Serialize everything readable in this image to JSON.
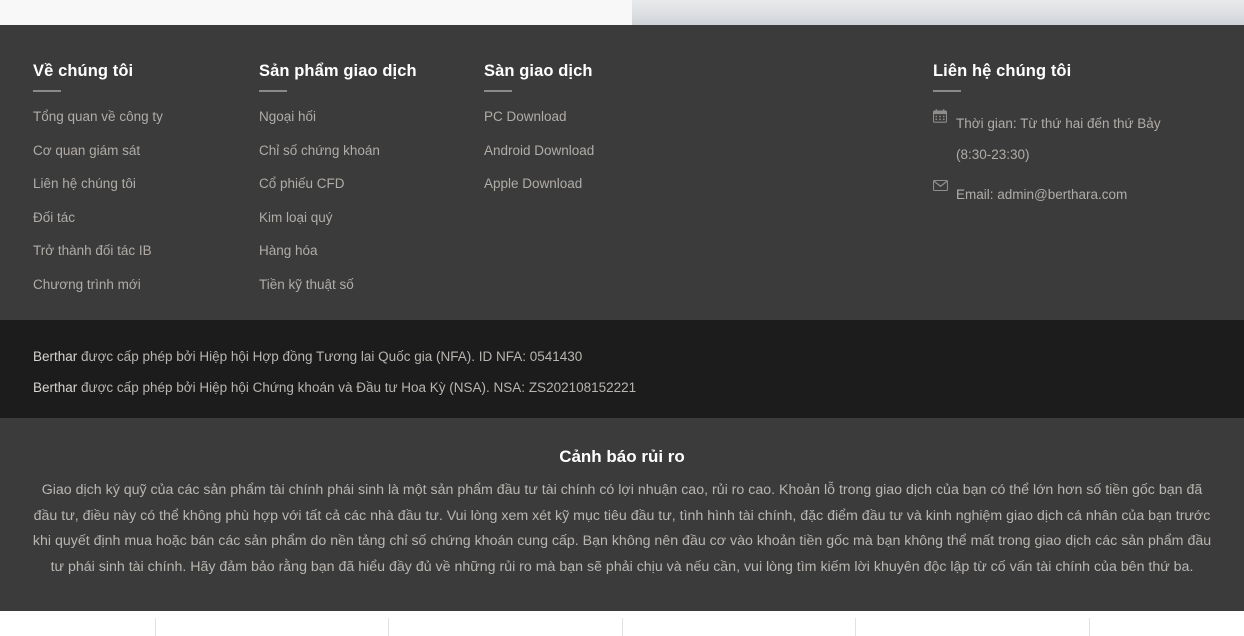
{
  "footer": {
    "columns": [
      {
        "title": "Về chúng tôi",
        "links": [
          "Tổng quan về công ty",
          "Cơ quan giám sát",
          "Liên hệ chúng tôi",
          "Đối tác",
          "Trở thành đối tác IB",
          "Chương trình mới"
        ]
      },
      {
        "title": "Sản phẩm giao dịch",
        "links": [
          "Ngoại hối",
          "Chỉ số chứng khoán",
          "Cổ phiếu CFD",
          "Kim loại quý",
          "Hàng hóa",
          "Tiền kỹ thuật số"
        ]
      },
      {
        "title": "Sàn giao dịch",
        "links": [
          "PC Download",
          "Android Download",
          "Apple Download"
        ]
      }
    ],
    "contact": {
      "title": "Liên hệ chúng tôi",
      "hours_icon": "calendar-icon",
      "hours_text": "Thời gian: Từ thứ hai đến thứ Bảy",
      "hours_text_2": "(8:30-23:30)",
      "email_icon": "envelope-icon",
      "email_text": "Email: admin@berthara.com"
    }
  },
  "license": {
    "brand": "Berthar",
    "line_1_rest": " được cấp phép bởi Hiệp hội Hợp đồng Tương lai Quốc gia (NFA). ID NFA: 0541430",
    "line_2_rest": " được cấp phép bởi Hiệp hội Chứng khoán và Đầu tư Hoa Kỳ (NSA). NSA: ZS202108152221"
  },
  "risk": {
    "title": "Cảnh báo rủi ro",
    "body": "Giao dịch ký quỹ của các sản phẩm tài chính phái sinh là một sản phẩm đầu tư tài chính có lợi nhuận cao, rủi ro cao. Khoản lỗ trong giao dịch của bạn có thể lớn hơn số tiền gốc bạn đã đầu tư, điều này có thể không phù hợp với tất cả các nhà đầu tư. Vui lòng xem xét kỹ mục tiêu đầu tư, tình hình tài chính, đặc điểm đầu tư và kinh nghiệm giao dịch cá nhân của bạn trước khi quyết định mua hoặc bán các sản phẩm do nền tảng chỉ số chứng khoán cung cấp. Bạn không nên đầu cơ vào khoản tiền gốc mà bạn không thể mất trong giao dịch các sản phẩm đầu tư phái sinh tài chính. Hãy đảm bảo rằng bạn đã hiểu đầy đủ về những rủi ro mà bạn sẽ phải chịu và nếu cần, vui lòng tìm kiếm lời khuyên độc lập từ cố vấn tài chính của bên thứ ba."
  },
  "colors": {
    "footer_bg": "#3b3b3b",
    "license_bg": "#1c1c1c",
    "risk_bg": "#3b3b3b",
    "heading_text": "#ffffff",
    "link_text": "#b0aca8",
    "body_text": "#b9b5b1",
    "rule": "#8a8a8a"
  }
}
